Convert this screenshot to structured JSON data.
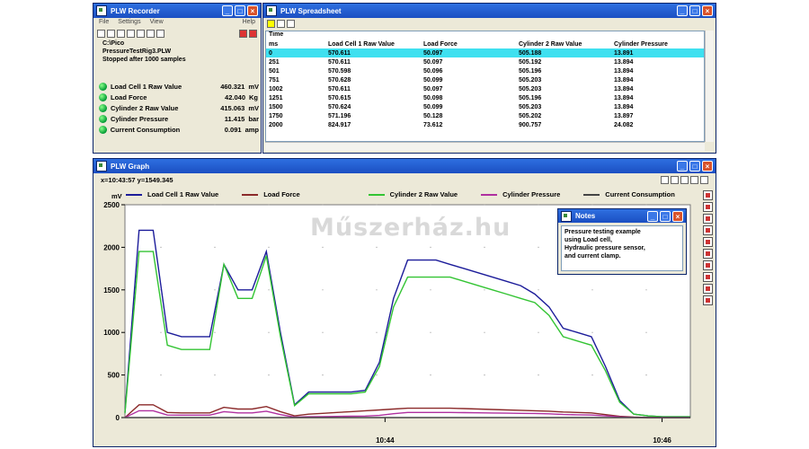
{
  "recorder": {
    "title": "PLW Recorder",
    "menu": [
      "File",
      "Settings",
      "View",
      "Help"
    ],
    "info": [
      "C:\\Pico",
      "PressureTestRig3.PLW",
      "Stopped after 1000 samples"
    ],
    "channels": [
      {
        "name": "Load Cell 1 Raw Value",
        "value": "460.321",
        "unit": "mV"
      },
      {
        "name": "Load Force",
        "value": "42.040",
        "unit": "Kg"
      },
      {
        "name": "Cylinder 2 Raw Value",
        "value": "415.063",
        "unit": "mV"
      },
      {
        "name": "Cylinder Pressure",
        "value": "11.415",
        "unit": "bar"
      },
      {
        "name": "Current Consumption",
        "value": "0.091",
        "unit": "amp"
      }
    ]
  },
  "spreadsheet": {
    "title": "PLW Spreadsheet",
    "col_time_top": "Time",
    "columns": [
      "ms",
      "Load Cell 1 Raw Value",
      "Load Force",
      "Cylinder 2 Raw Value",
      "Cylinder Pressure"
    ],
    "rows": [
      [
        "0",
        "570.611",
        "50.097",
        "505.188",
        "13.891"
      ],
      [
        "251",
        "570.611",
        "50.097",
        "505.192",
        "13.894"
      ],
      [
        "501",
        "570.598",
        "50.096",
        "505.196",
        "13.894"
      ],
      [
        "751",
        "570.628",
        "50.099",
        "505.203",
        "13.894"
      ],
      [
        "1002",
        "570.611",
        "50.097",
        "505.203",
        "13.894"
      ],
      [
        "1251",
        "570.615",
        "50.098",
        "505.196",
        "13.894"
      ],
      [
        "1500",
        "570.624",
        "50.099",
        "505.203",
        "13.894"
      ],
      [
        "1750",
        "571.196",
        "50.128",
        "505.202",
        "13.897"
      ],
      [
        "2000",
        "824.917",
        "73.612",
        "900.757",
        "24.082"
      ]
    ]
  },
  "graph": {
    "title": "PLW Graph",
    "cursor_readout": "x=10:43:57 y=1549.345",
    "yunit": "mV",
    "legend": [
      {
        "name": "Load Cell 1 Raw Value",
        "color": "#1c1c9a"
      },
      {
        "name": "Load Force",
        "color": "#8b2a2a"
      },
      {
        "name": "Cylinder 2 Raw Value",
        "color": "#33c433"
      },
      {
        "name": "Cylinder Pressure",
        "color": "#b030a0"
      },
      {
        "name": "Current Consumption",
        "color": "#444444"
      }
    ],
    "yticks": [
      "2500",
      "2000",
      "1500",
      "1000",
      "500",
      "0"
    ],
    "xticks": [
      "10:44",
      "10:46"
    ]
  },
  "notes": {
    "title": "Notes",
    "text": [
      "Pressure testing example",
      "using Load cell,",
      "Hydraulic pressure sensor,",
      "and current clamp."
    ]
  },
  "watermark": "Műszerház.hu",
  "chart_data": {
    "type": "line",
    "ylim": [
      0,
      2500
    ],
    "xlabel": "",
    "ylabel": "mV",
    "t": [
      0,
      1,
      2,
      3,
      4,
      5,
      6,
      7,
      8,
      9,
      10,
      11,
      12,
      13,
      14,
      15,
      16,
      17,
      18,
      19,
      20,
      21,
      22,
      23,
      24,
      25,
      26,
      27,
      28,
      29,
      30,
      31,
      32,
      33,
      34,
      35,
      36,
      37,
      38,
      39,
      40
    ],
    "series": [
      {
        "name": "Load Cell 1 Raw Value",
        "color": "#1c1c9a",
        "values": [
          60,
          2200,
          2200,
          1000,
          950,
          950,
          950,
          1800,
          1500,
          1500,
          1950,
          1000,
          150,
          300,
          300,
          300,
          300,
          320,
          650,
          1400,
          1850,
          1850,
          1850,
          1800,
          1750,
          1700,
          1650,
          1600,
          1550,
          1450,
          1300,
          1050,
          1000,
          950,
          600,
          200,
          40,
          20,
          10,
          10,
          10
        ]
      },
      {
        "name": "Load Force",
        "color": "#8b2a2a",
        "values": [
          0,
          150,
          150,
          60,
          55,
          55,
          55,
          120,
          100,
          100,
          130,
          70,
          20,
          40,
          50,
          60,
          70,
          80,
          90,
          100,
          110,
          110,
          110,
          110,
          105,
          100,
          95,
          90,
          85,
          80,
          75,
          65,
          60,
          55,
          35,
          15,
          5,
          0,
          0,
          0,
          0
        ]
      },
      {
        "name": "Cylinder 2 Raw Value",
        "color": "#33c433",
        "values": [
          50,
          1950,
          1950,
          850,
          800,
          800,
          800,
          1800,
          1400,
          1400,
          1900,
          950,
          140,
          280,
          280,
          280,
          280,
          300,
          600,
          1300,
          1650,
          1650,
          1650,
          1650,
          1600,
          1550,
          1500,
          1450,
          1400,
          1350,
          1200,
          950,
          900,
          850,
          550,
          180,
          40,
          20,
          10,
          10,
          10
        ]
      },
      {
        "name": "Cylinder Pressure",
        "color": "#b030a0",
        "values": [
          0,
          80,
          80,
          30,
          28,
          28,
          28,
          70,
          55,
          55,
          75,
          35,
          5,
          10,
          12,
          14,
          16,
          18,
          25,
          45,
          60,
          60,
          60,
          60,
          58,
          56,
          54,
          52,
          50,
          48,
          44,
          36,
          33,
          30,
          20,
          8,
          2,
          0,
          0,
          0,
          0
        ]
      },
      {
        "name": "Current Consumption",
        "color": "#444444",
        "values": [
          0,
          0,
          0,
          0,
          0,
          0,
          0,
          0,
          0,
          0,
          0,
          0,
          0,
          0,
          0,
          0,
          0,
          0,
          0,
          0,
          0,
          0,
          0,
          0,
          0,
          0,
          0,
          0,
          0,
          0,
          0,
          0,
          0,
          0,
          0,
          0,
          0,
          0,
          0,
          0,
          0
        ]
      }
    ]
  }
}
